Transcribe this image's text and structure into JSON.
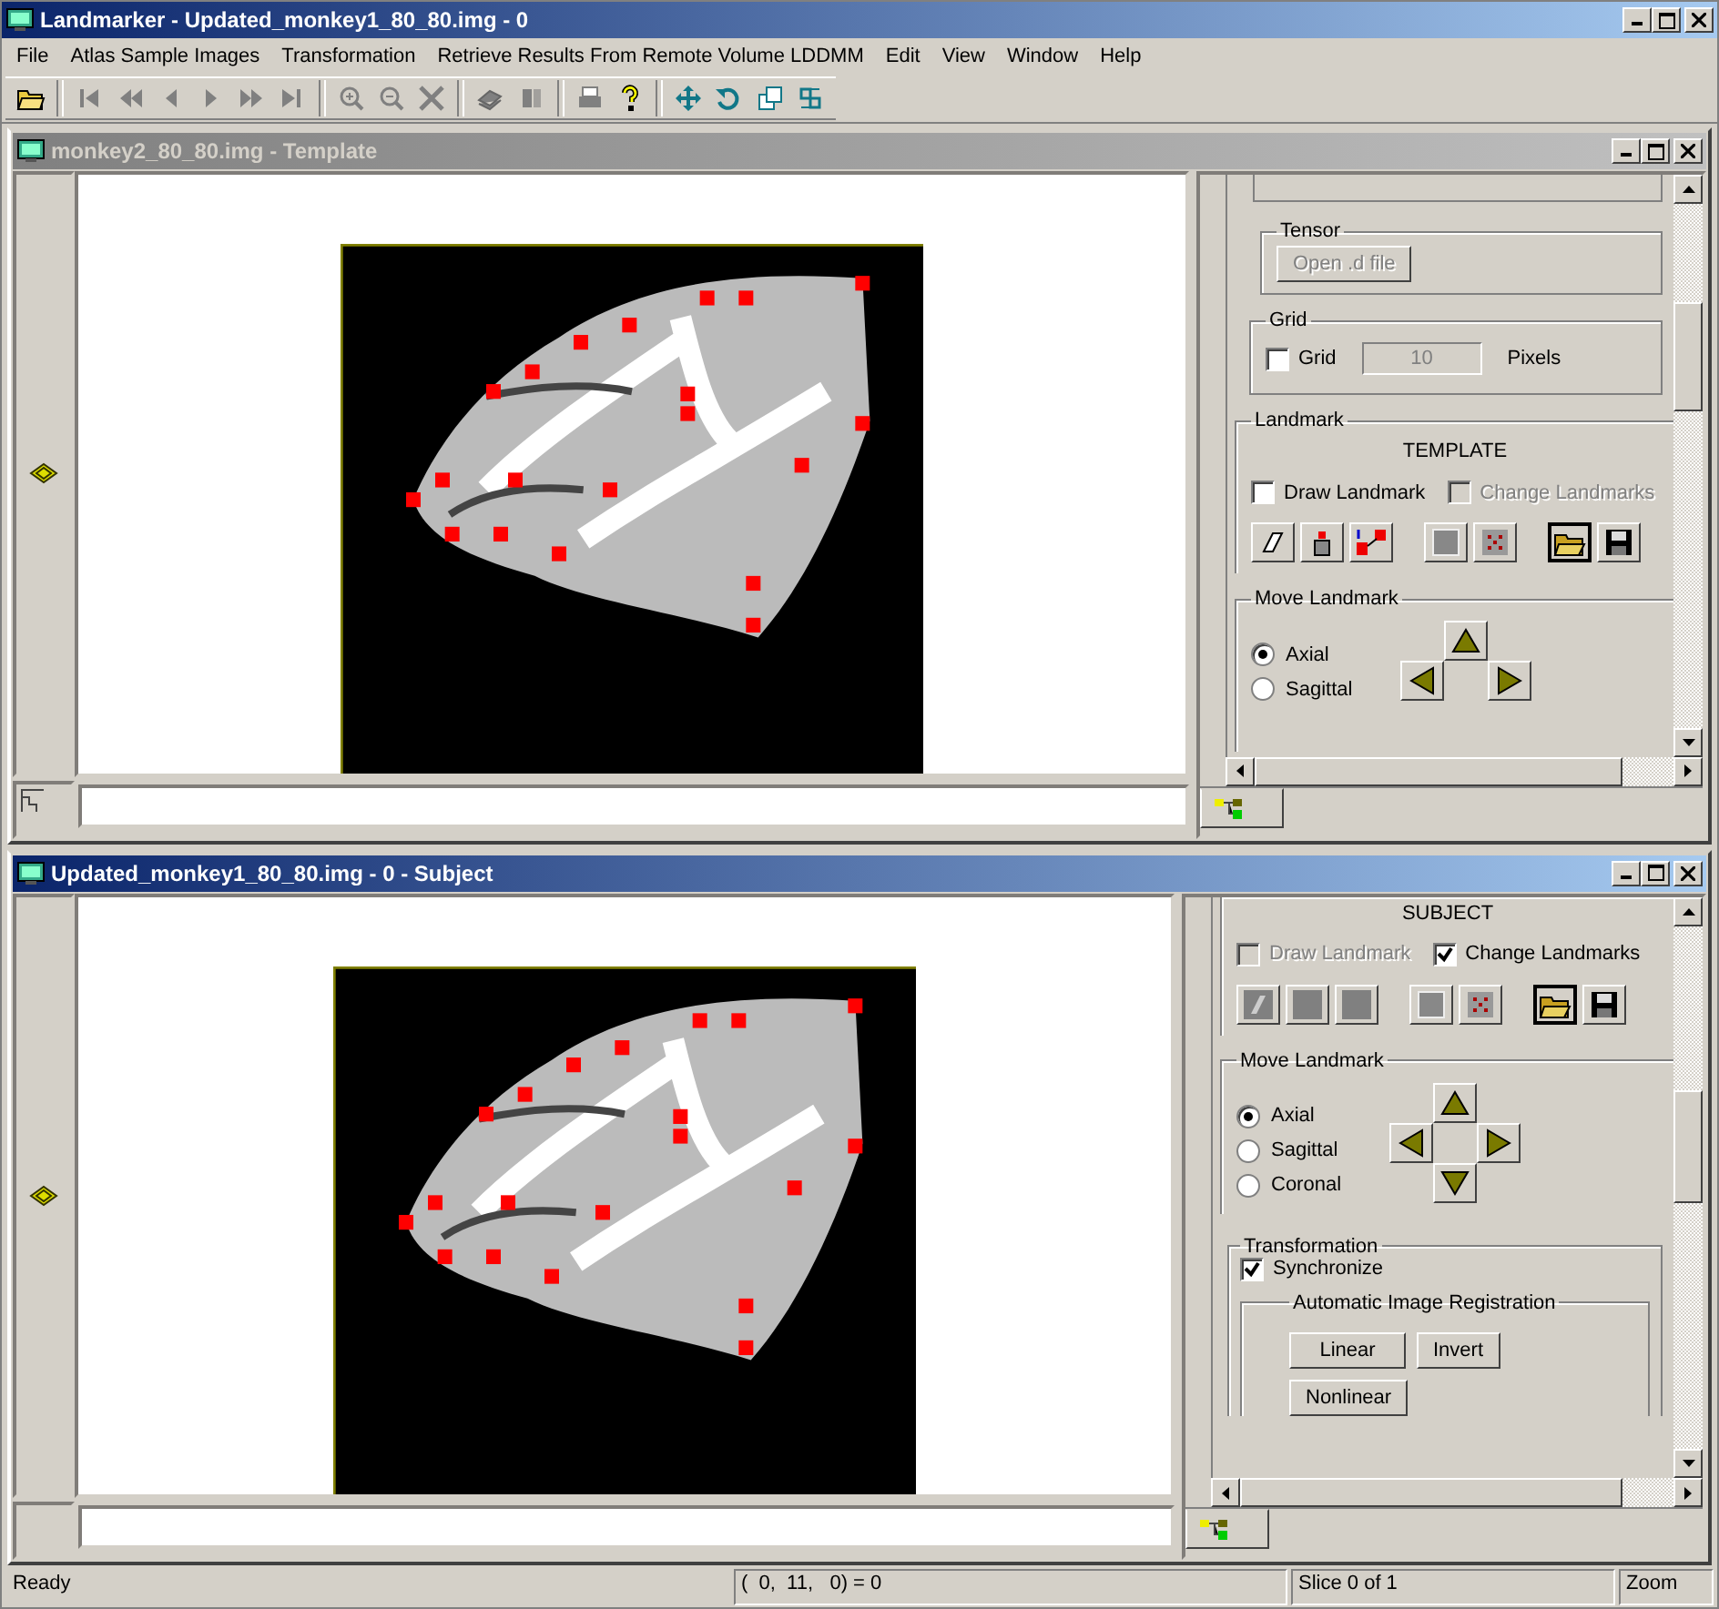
{
  "window": {
    "title": "Landmarker - Updated_monkey1_80_80.img - 0"
  },
  "menu": [
    {
      "label": "File"
    },
    {
      "label": "Atlas Sample Images"
    },
    {
      "label": "Transformation"
    },
    {
      "label": "Retrieve Results From Remote Volume LDDMM"
    },
    {
      "label": "Edit"
    },
    {
      "label": "View"
    },
    {
      "label": "Window"
    },
    {
      "label": "Help"
    }
  ],
  "windows": [
    {
      "title": "monkey2_80_80.img - Template",
      "active": false,
      "panel": {
        "tensor": {
          "legend": "Tensor",
          "button": "Open .d file",
          "disabled": true
        },
        "grid": {
          "legend": "Grid",
          "checkbox": {
            "label": "Grid",
            "checked": false
          },
          "value": "10",
          "unit": "Pixels",
          "disabled": true
        },
        "landmark": {
          "legend": "Landmark",
          "heading": "TEMPLATE",
          "draw": {
            "label": "Draw Landmark",
            "checked": false,
            "disabled": false
          },
          "change": {
            "label": "Change Landmarks",
            "checked": false,
            "disabled": true
          },
          "tools_disabled": false
        },
        "move": {
          "legend": "Move Landmark",
          "options": [
            {
              "label": "Axial",
              "selected": true
            },
            {
              "label": "Sagittal",
              "selected": false
            }
          ]
        }
      }
    },
    {
      "title": "Updated_monkey1_80_80.img - 0 - Subject",
      "active": true,
      "panel": {
        "landmark": {
          "heading": "SUBJECT",
          "draw": {
            "label": "Draw Landmark",
            "checked": false,
            "disabled": true
          },
          "change": {
            "label": "Change Landmarks",
            "checked": true,
            "disabled": false
          },
          "tools_disabled": true
        },
        "move": {
          "legend": "Move Landmark",
          "options": [
            {
              "label": "Axial",
              "selected": true
            },
            {
              "label": "Sagittal",
              "selected": false
            },
            {
              "label": "Coronal",
              "selected": false
            }
          ]
        },
        "transformation": {
          "legend": "Transformation",
          "synchronize": {
            "label": "Synchronize",
            "checked": true
          },
          "registration": {
            "legend": "Automatic Image Registration",
            "buttons": [
              "Linear",
              "Invert",
              "Nonlinear"
            ]
          }
        }
      }
    }
  ],
  "status_bar": {
    "message": "Ready",
    "coordinates": "(  0,  11,   0) = 0",
    "slice": "Slice 0 of 1",
    "zoom": "Zoom"
  }
}
